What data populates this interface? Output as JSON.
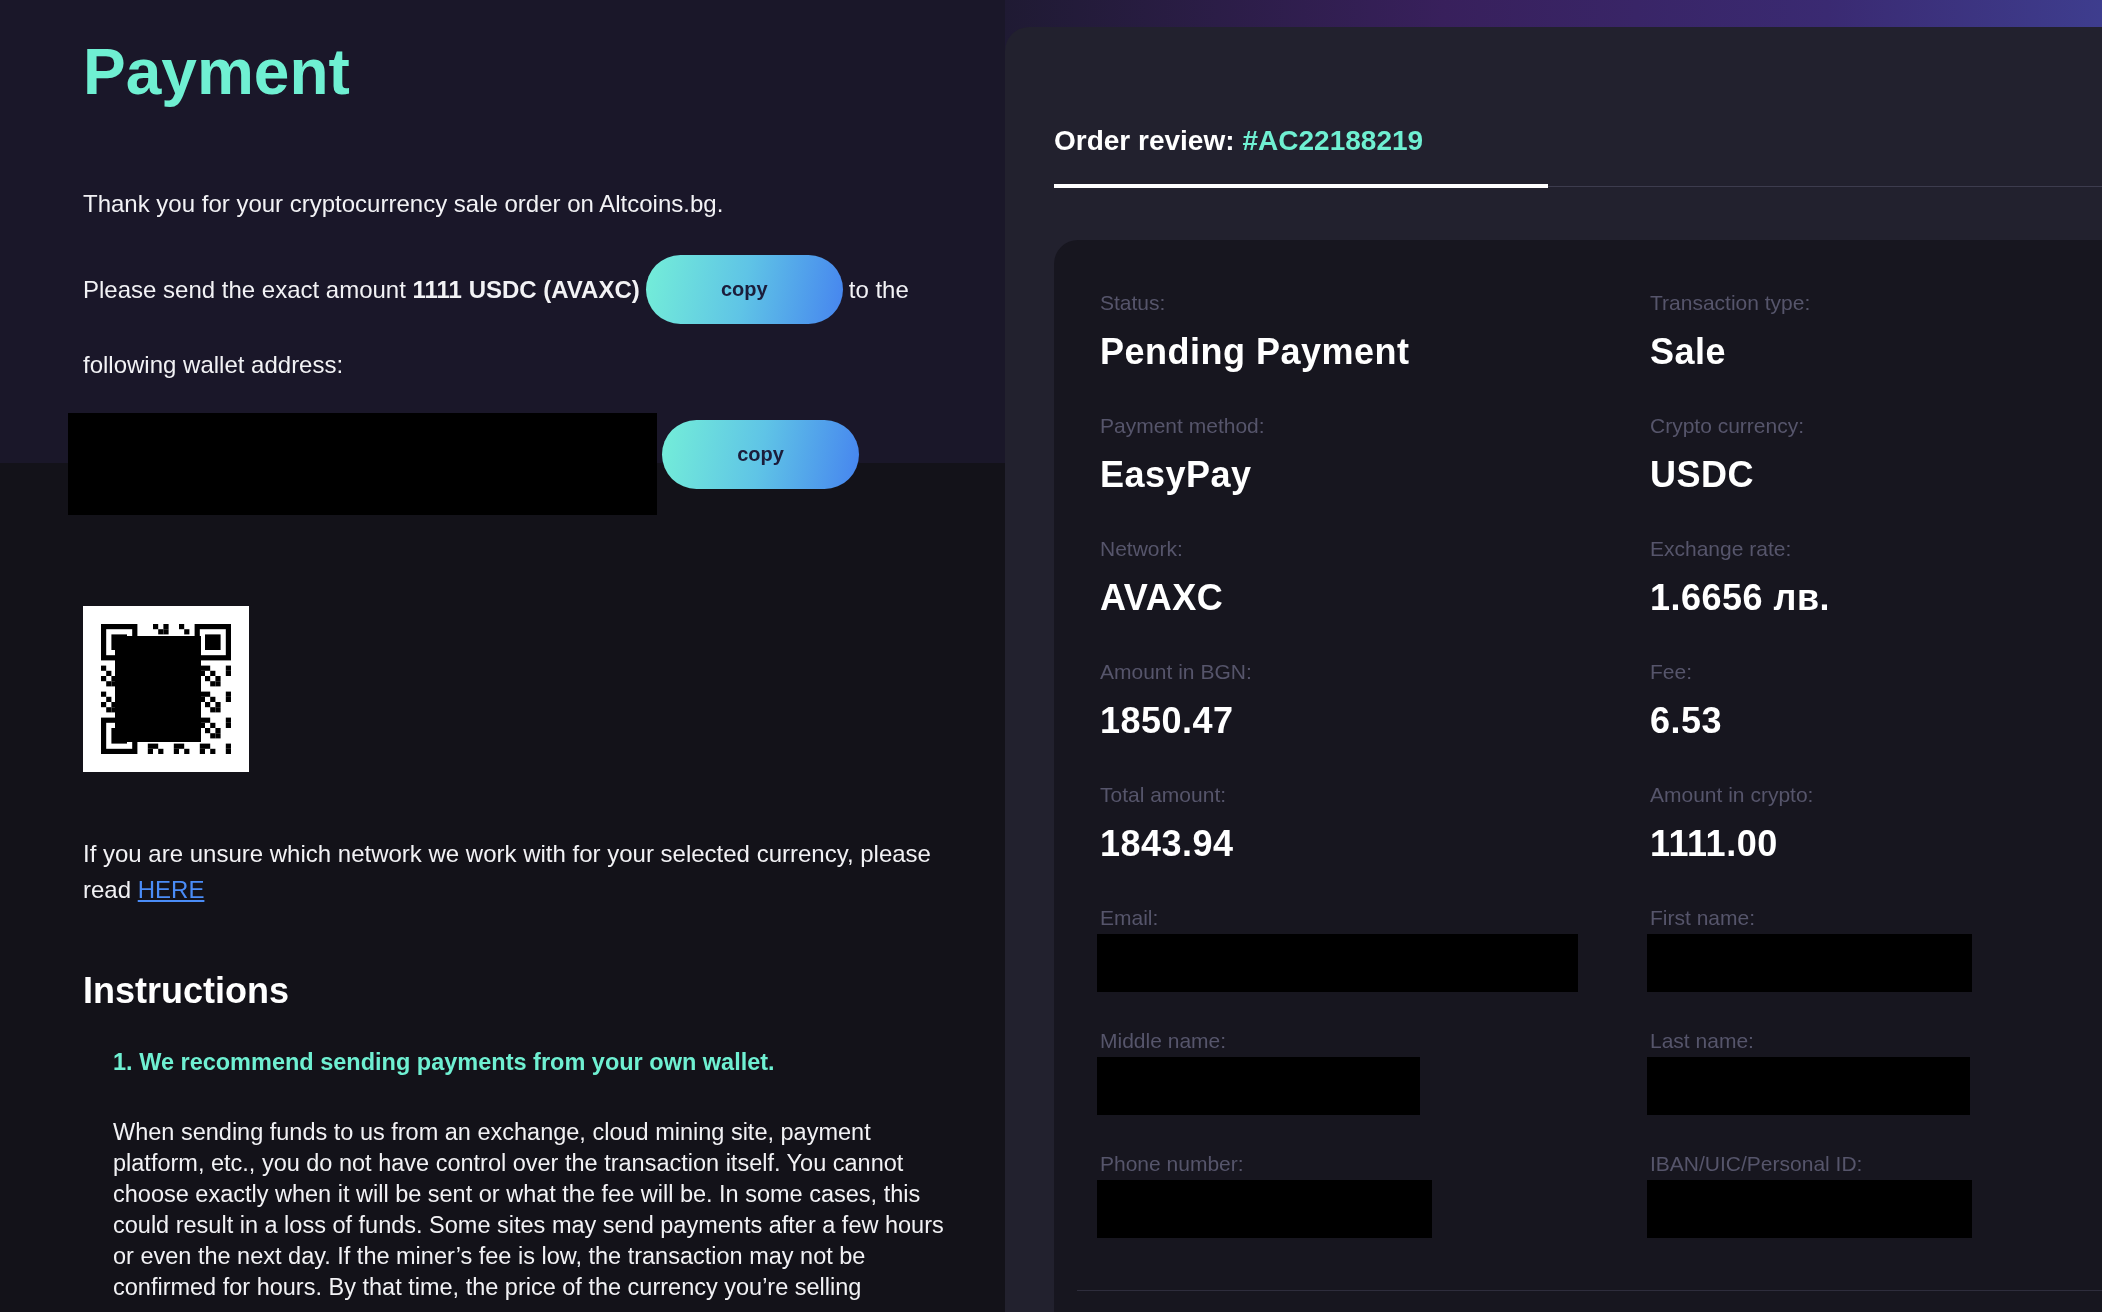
{
  "page_title": "Payment",
  "intro": "Thank you for your cryptocurrency sale order on Altcoins.bg.",
  "amount_line": {
    "text": "Please send the exact amount **1111 USDC (AVAXC)**",
    "copy_button": "copy",
    "text_after": "to the"
  },
  "wallet_line": "following wallet address:",
  "wallet": {
    "copy_button": "copy"
  },
  "network_note": {
    "text": "If you are unsure which network we work with for your selected currency, please read",
    "link": "HERE"
  },
  "instructions": {
    "heading": "Instructions",
    "items": [
      {
        "title": "1. We recommend sending payments from your own wallet.",
        "body": "When sending funds to us from an exchange, cloud mining site, payment platform, etc., you do not have control over the transaction itself. You cannot choose exactly when it will be sent or what the fee will be. In some cases, this could result in a loss of funds. Some sites may send payments after a few hours or even the next day. If the miner’s fee is low, the transaction may not be confirmed for hours. By that time, the price of the currency you’re selling"
      }
    ]
  },
  "order_review": {
    "tabs": [
      {
        "label": "Order review:",
        "order_id": "#AC22188219",
        "selected": true
      }
    ],
    "fields": [
      {
        "label": "Status:",
        "kind": "value",
        "value": "Pending Payment"
      },
      {
        "label": "Transaction type:",
        "kind": "value",
        "value": "Sale"
      },
      {
        "label": "Payment method:",
        "kind": "value",
        "value": "EasyPay"
      },
      {
        "label": "Crypto currency:",
        "kind": "value",
        "value": "USDC"
      },
      {
        "label": "Network:",
        "kind": "value",
        "value": "AVAXC"
      },
      {
        "label": "Exchange rate:",
        "kind": "value",
        "value": "1.6656 лв."
      },
      {
        "label": "Amount in BGN:",
        "kind": "value",
        "value": "1850.47"
      },
      {
        "label": "Fee:",
        "kind": "value",
        "value": "6.53"
      },
      {
        "label": "Total amount:",
        "kind": "value",
        "value": "1843.94"
      },
      {
        "label": "Amount in crypto:",
        "kind": "value",
        "value": "1111.00"
      },
      {
        "label": "Email:",
        "kind": "redacted"
      },
      {
        "label": "First name:",
        "kind": "redacted"
      },
      {
        "label": "Middle name:",
        "kind": "redacted"
      },
      {
        "label": "Last name:",
        "kind": "redacted"
      },
      {
        "label": "Phone number:",
        "kind": "redacted"
      },
      {
        "label": "IBAN/UIC/Personal ID:",
        "kind": "redacted"
      }
    ]
  }
}
